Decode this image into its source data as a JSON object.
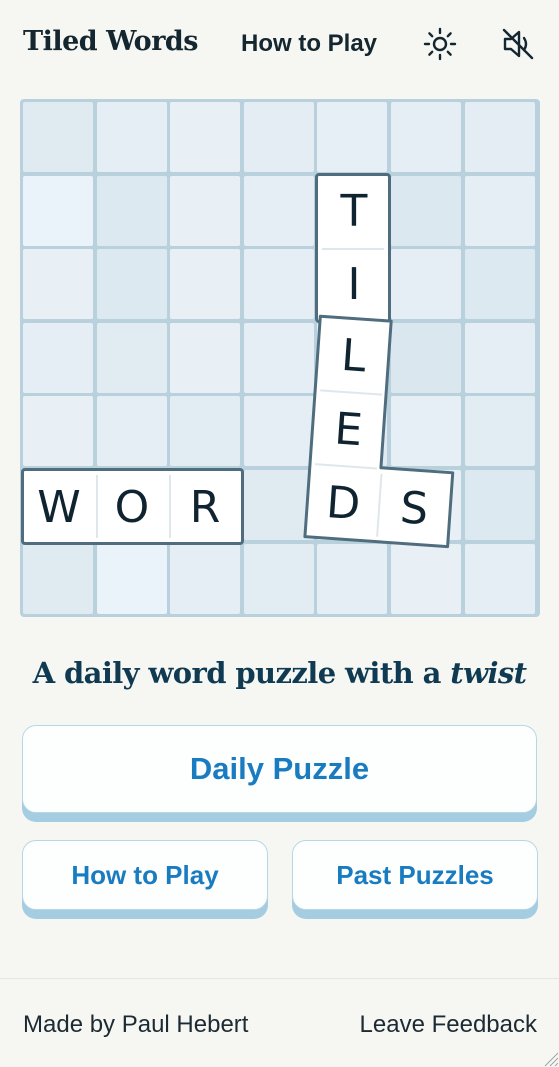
{
  "header": {
    "brand": "Tiled Words",
    "nav_how_to_play": "How to Play",
    "theme_icon": "sun-icon",
    "sound_icon": "sound-muted-icon"
  },
  "board": {
    "cols": 7,
    "rows": 7,
    "cell_shades": [
      [
        "#dfeaf1",
        "#e5eef4",
        "#e8f0f6",
        "#e3edf3",
        "#e7eff6",
        "#e5eef4",
        "#e3edf3"
      ],
      [
        "#eaf3fa",
        "#dde9f1",
        "#e8f0f6",
        "#e4eef4",
        "#e8f0f6",
        "#dce8f0",
        "#e4eef4"
      ],
      [
        "#e8f0f6",
        "#dde9f1",
        "#e8f0f6",
        "#e4eef4",
        "#e8f0f6",
        "#e4eef4",
        "#dde9f1"
      ],
      [
        "#e4eef4",
        "#e1ebf2",
        "#e8f0f6",
        "#e4eef4",
        "#e4eef4",
        "#dbe7ef",
        "#e4eef4"
      ],
      [
        "#e8f0f6",
        "#e4eef4",
        "#e2ecf3",
        "#e4eef4",
        "#dfeaf1",
        "#e6eff5",
        "#e2ecf3"
      ],
      [
        "#e4eef4",
        "#e8f0f6",
        "#e8f0f6",
        "#dfeaf1",
        "#e4eef4",
        "#e8f0f6",
        "#dde9f1"
      ],
      [
        "#dfeaf1",
        "#eaf3fa",
        "#e4eef4",
        "#e2ecf3",
        "#e4eef4",
        "#e8f0f6",
        "#e4eef4"
      ]
    ],
    "words": {
      "word_row": [
        "W",
        "O",
        "R"
      ],
      "tiled_top": [
        "T",
        "I"
      ],
      "tiled_bottom": [
        "L",
        "E",
        "D"
      ],
      "tiled_end": "S"
    },
    "tile_border_color": "#4f6d7e"
  },
  "tagline": {
    "before": "A daily word puzzle with a ",
    "emphasis": "twist"
  },
  "buttons": {
    "daily": "Daily Puzzle",
    "how_to_play": "How to Play",
    "past": "Past Puzzles"
  },
  "footer": {
    "credit": "Made by Paul Hebert",
    "feedback": "Leave Feedback"
  },
  "colors": {
    "accent": "#1a7cc0",
    "button_shadow": "#a5cde2",
    "tagline": "#0f3a52",
    "background": "#f6f7f3"
  }
}
